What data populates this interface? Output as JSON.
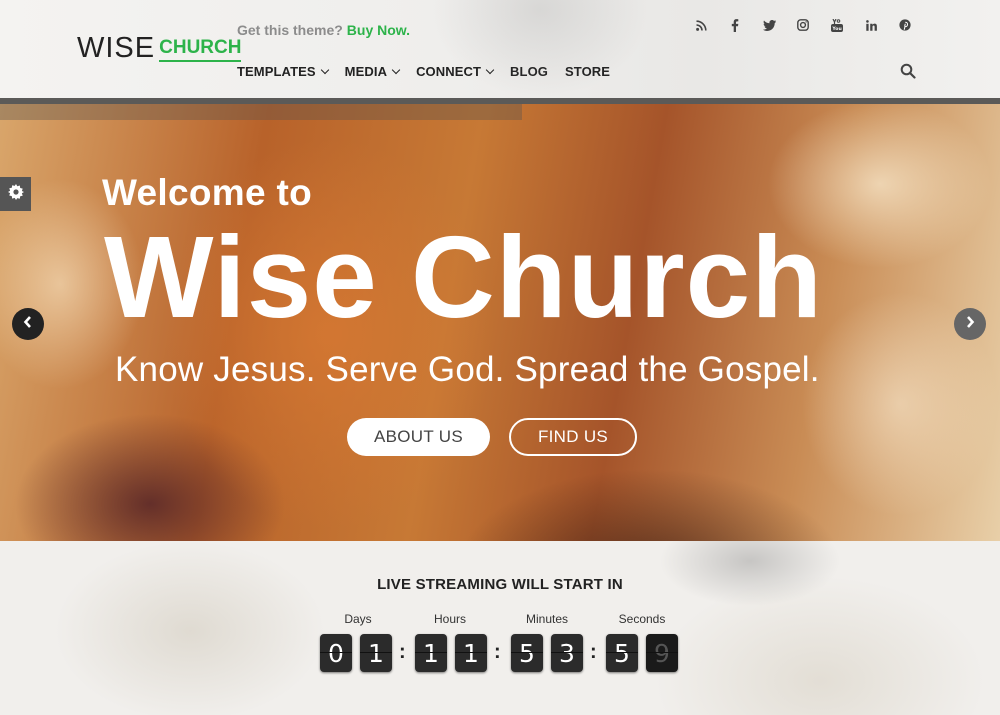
{
  "header": {
    "logo": {
      "wise": "WISE",
      "church": "CHURCH"
    },
    "promo": {
      "text": "Get this theme?",
      "link": "Buy Now."
    },
    "nav": [
      {
        "label": "TEMPLATES",
        "dropdown": true
      },
      {
        "label": "MEDIA",
        "dropdown": true
      },
      {
        "label": "CONNECT",
        "dropdown": true
      },
      {
        "label": "BLOG",
        "dropdown": false
      },
      {
        "label": "STORE",
        "dropdown": false
      }
    ],
    "social_icons": [
      "rss-icon",
      "facebook-icon",
      "twitter-icon",
      "instagram-icon",
      "youtube-icon",
      "linkedin-icon",
      "pinterest-icon"
    ]
  },
  "hero": {
    "welcome": "Welcome to",
    "title": "Wise Church",
    "tagline": "Know Jesus. Serve God. Spread the Gospel.",
    "buttons": {
      "about": "ABOUT US",
      "find": "FIND US"
    }
  },
  "countdown": {
    "title": "LIVE STREAMING WILL START IN",
    "labels": {
      "days": "Days",
      "hours": "Hours",
      "minutes": "Minutes",
      "seconds": "Seconds"
    },
    "digits": {
      "days": [
        "0",
        "1"
      ],
      "hours": [
        "1",
        "1"
      ],
      "minutes": [
        "5",
        "3"
      ],
      "seconds": [
        "5",
        "9"
      ]
    }
  },
  "colors": {
    "accent": "#2db34a",
    "dark": "#222222",
    "divider": "#5b5a58"
  }
}
